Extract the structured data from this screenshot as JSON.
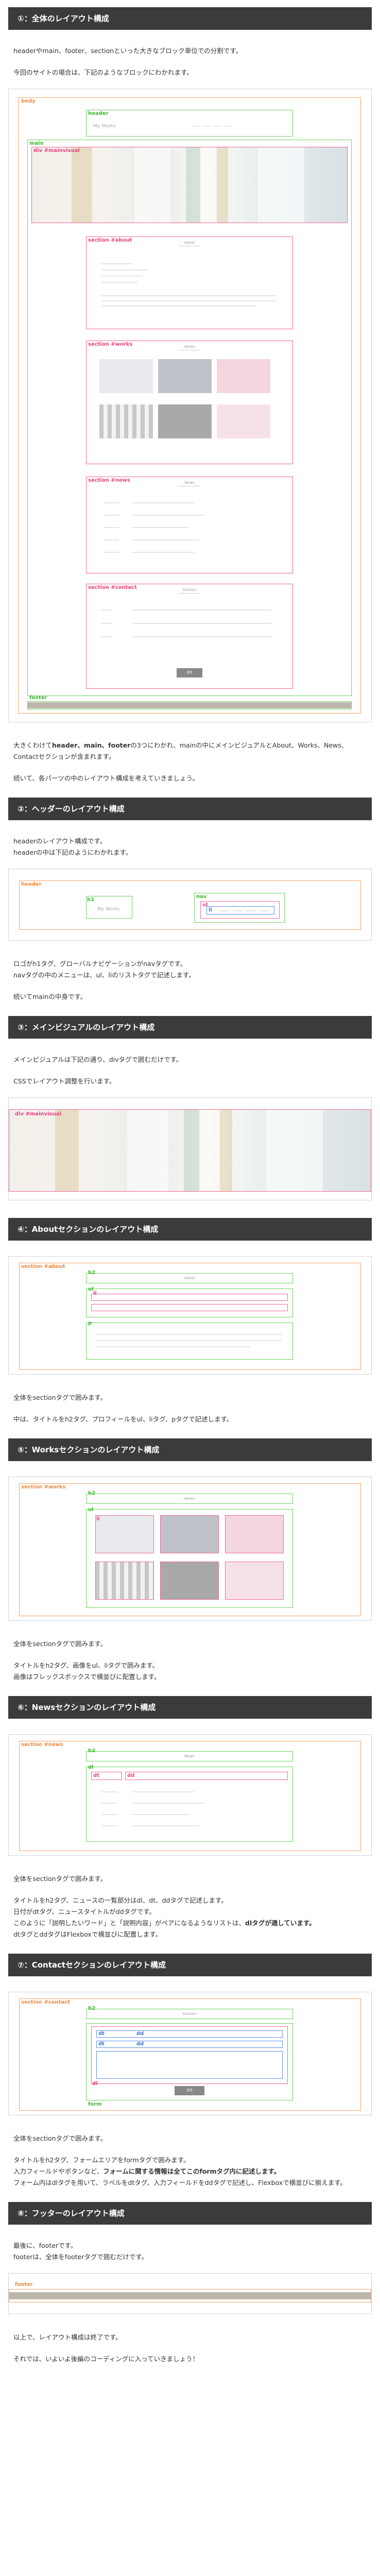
{
  "sections": [
    {
      "title": "①：全体のレイアウト構成"
    },
    {
      "title": "②：ヘッダーのレイアウト構成"
    },
    {
      "title": "③：メインビジュアルのレイアウト構成"
    },
    {
      "title": "④：Aboutセクションのレイアウト構成"
    },
    {
      "title": "⑤：Worksセクションのレイアウト構成"
    },
    {
      "title": "⑥：Newsセクションのレイアウト構成"
    },
    {
      "title": "⑦：Contactセクションのレイアウト構成"
    },
    {
      "title": "⑧：フッターのレイアウト構成"
    }
  ],
  "s1": {
    "p1": "headerやmain、footer、sectionといった大きなブロック単位での分割です。",
    "p2": "今回のサイトの場合は、下記のようなブロックにわかれます。",
    "p3_a": "大きくわけて",
    "p3_b": "header、main、footer",
    "p3_c": "の3つにわかれ、mainの中にメインビジュアルとAbout、Works、News、Contactセクションが含まれます。",
    "p4": "続いて、各パーツの中のレイアウト構成を考えていきましょう。",
    "labels": {
      "body": "body",
      "header": "header",
      "main": "main",
      "mv": "div #mainvisual",
      "about": "section #about",
      "works": "section #works",
      "news": "section #news",
      "contact": "section #contact",
      "footer": "footer"
    },
    "logo": "My Works",
    "sec_titles": {
      "about": "About",
      "works": "Works",
      "news": "News",
      "contact": "Contact"
    },
    "send": "送信"
  },
  "s2": {
    "p1": "headerのレイアウト構成です。",
    "p2": "headerの中は下記のようにわかれます。",
    "p3": "ロゴがh1タグ、グローバルナビゲーションがnavタグです。",
    "p4": "navタグの中のメニューは、ul、liのリストタグで記述します。",
    "p5": "続いてmainの中身です。",
    "labels": {
      "header": "header",
      "h1": "h1",
      "nav": "nav",
      "ul": "ul",
      "li": "li"
    },
    "logo": "My Works"
  },
  "s3": {
    "p1": "メインビジュアルは下記の通り、divタグで囲むだけです。",
    "p2": "CSSでレイアウト調整を行います。",
    "labels": {
      "mv": "div #mainvisual"
    }
  },
  "s4": {
    "p1": "全体をsectionタグで囲みます。",
    "p2": "中は、タイトルをh2タグ、プロフィールをul、liタグ、pタグで記述します。",
    "labels": {
      "section": "section #about",
      "h2": "h2",
      "ul": "ul",
      "li": "li",
      "p": "p"
    },
    "title": "About"
  },
  "s5": {
    "p1": "全体をsectionタグで囲みます。",
    "p2": "タイトルをh2タグ、画像をul、liタグで囲みます。",
    "p3": "画像はフレックスボックスで横並びに配置します。",
    "labels": {
      "section": "section #works",
      "h2": "h2",
      "ul": "ul",
      "li": "li"
    },
    "title": "Works"
  },
  "s6": {
    "p1": "全体をsectionタグで囲みます。",
    "p2": "タイトルをh2タグ、ニュースの一覧部分はdl、dt、ddタグで記述します。",
    "p3": "日付がdtタグ、ニュースタイトルがddタグです。",
    "p4_a": "このように「説明したいワード」と「説明内容」がペアになるようなリストは、",
    "p4_b": "dlタグが適しています。",
    "p5": "dtタグとddタグはFlexboxで横並びに配置します。",
    "labels": {
      "section": "section #news",
      "h2": "h2",
      "dl": "dl",
      "dt": "dt",
      "dd": "dd"
    },
    "title": "News"
  },
  "s7": {
    "p1": "全体をsectionタグで囲みます。",
    "p2": "タイトルをh2タグ、フォームエリアをformタグで囲みます。",
    "p3_a": "入力フィールドやボタンなど、",
    "p3_b": "フォームに関する情報は全てこのformタグ内に記述します。",
    "p4": "フォーム内はdlタグを用いて、ラベルをdtタグ、入力フィールドをddタグで記述し、Flexboxで横並びに揃えます。",
    "labels": {
      "section": "section #contact",
      "h2": "h2",
      "dl": "dl",
      "dt": "dt",
      "dd": "dd",
      "form": "form"
    },
    "title": "Contact",
    "send": "送信"
  },
  "s8": {
    "p1": "最後に、footerです。",
    "p2": "footerは、全体をfooterタグで囲むだけです。",
    "p3": "以上で、レイアウト構成は終了です。",
    "p4": "それでは、いよいよ後編のコーディングに入っていきましょう！",
    "labels": {
      "footer": "footer"
    }
  },
  "colors": {
    "heading_bg": "#3b3b3b",
    "orange": "#f2a266",
    "green": "#6dd35f",
    "pink": "#f06797",
    "blue": "#5b8fe8"
  }
}
